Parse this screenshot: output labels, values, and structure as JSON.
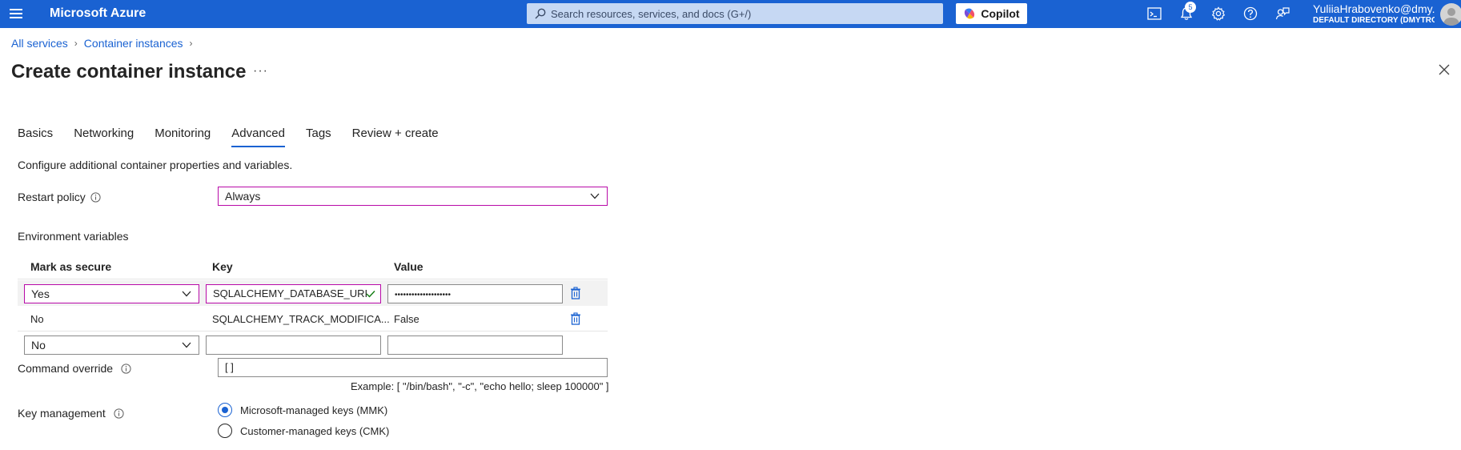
{
  "topbar": {
    "brand": "Microsoft Azure",
    "search_placeholder": "Search resources, services, and docs (G+/)",
    "copilot_label": "Copilot",
    "notification_count": "5",
    "user_name": "YuliiaHrabovenko@dmy...",
    "user_directory": "DEFAULT DIRECTORY (DMYTROS..."
  },
  "breadcrumb": [
    "All services",
    "Container instances"
  ],
  "page": {
    "title": "Create container instance",
    "more": "···"
  },
  "tabs": [
    "Basics",
    "Networking",
    "Monitoring",
    "Advanced",
    "Tags",
    "Review + create"
  ],
  "active_tab": "Advanced",
  "description": "Configure additional container properties and variables.",
  "restart_policy": {
    "label": "Restart policy",
    "value": "Always"
  },
  "env_vars": {
    "section_label": "Environment variables",
    "headers": {
      "secure": "Mark as secure",
      "key": "Key",
      "value": "Value"
    },
    "rows": [
      {
        "secure": "Yes",
        "key": "SQLALCHEMY_DATABASE_URI",
        "value": "••••••••••••••••••••"
      },
      {
        "secure": "No",
        "key": "SQLALCHEMY_TRACK_MODIFICA...",
        "value": "False"
      },
      {
        "secure": "No",
        "key": "",
        "value": ""
      }
    ]
  },
  "command_override": {
    "label": "Command override",
    "value": "[ ]",
    "example": "Example: [ \"/bin/bash\", \"-c\", \"echo hello; sleep 100000\" ]"
  },
  "key_management": {
    "label": "Key management",
    "options": [
      "Microsoft-managed keys (MMK)",
      "Customer-managed keys (CMK)"
    ],
    "selected": "Microsoft-managed keys (MMK)"
  },
  "colors": {
    "accent": "#1a62d2",
    "focus_border": "#b80aa8",
    "success": "#107c10"
  }
}
